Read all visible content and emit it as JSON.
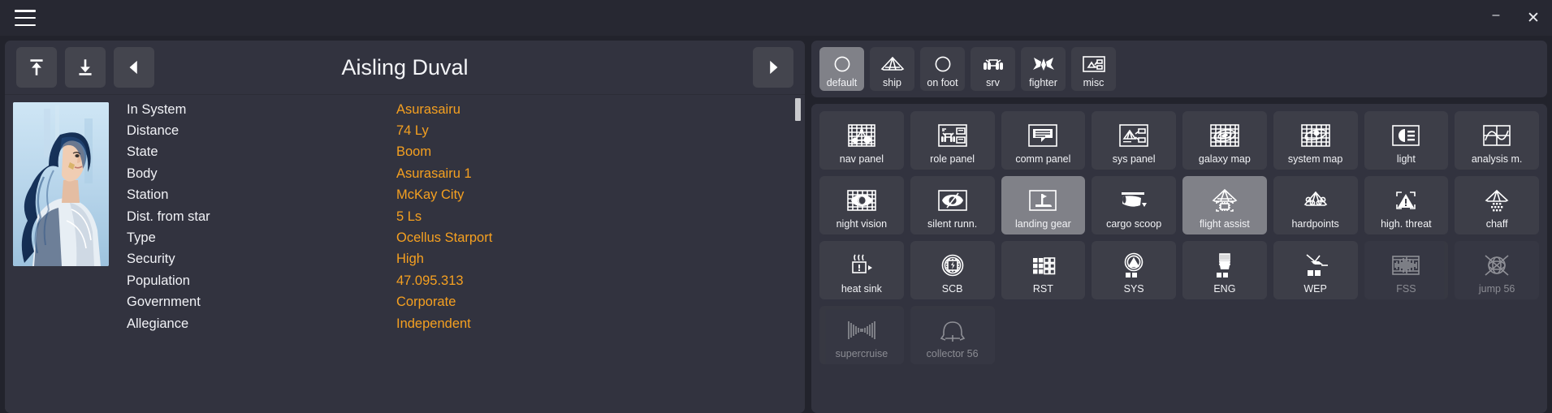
{
  "window": {
    "menu_icon": "hamburger-icon",
    "minimize_label": "–",
    "close_label": "✕"
  },
  "card": {
    "title": "Aisling Duval",
    "buttons": {
      "first_label": "to-top",
      "last_label": "to-bottom",
      "prev_label": "previous",
      "next_label": "next"
    }
  },
  "details": [
    {
      "label": "In System",
      "value": "Asurasairu"
    },
    {
      "label": "Distance",
      "value": "74 Ly"
    },
    {
      "label": "State",
      "value": "Boom"
    },
    {
      "label": "Body",
      "value": "Asurasairu 1"
    },
    {
      "label": "Station",
      "value": "McKay City"
    },
    {
      "label": "Dist. from star",
      "value": "5 Ls"
    },
    {
      "label": "Type",
      "value": "Ocellus Starport"
    },
    {
      "label": "Security",
      "value": "High"
    },
    {
      "label": "Population",
      "value": "47.095.313"
    },
    {
      "label": "Government",
      "value": "Corporate"
    },
    {
      "label": "Allegiance",
      "value": "Independent"
    }
  ],
  "tabs": [
    {
      "label": "default",
      "icon": "circle-icon",
      "active": true
    },
    {
      "label": "ship",
      "icon": "ship-icon",
      "active": false
    },
    {
      "label": "on foot",
      "icon": "circle-icon",
      "active": false
    },
    {
      "label": "srv",
      "icon": "srv-icon",
      "active": false
    },
    {
      "label": "fighter",
      "icon": "fighter-icon",
      "active": false
    },
    {
      "label": "misc",
      "icon": "misc-icon",
      "active": false
    }
  ],
  "grid": [
    {
      "label": "nav panel",
      "icon": "nav-panel-icon",
      "active": false,
      "dim": false
    },
    {
      "label": "role panel",
      "icon": "role-panel-icon",
      "active": false,
      "dim": false
    },
    {
      "label": "comm panel",
      "icon": "comm-panel-icon",
      "active": false,
      "dim": false
    },
    {
      "label": "sys panel",
      "icon": "sys-panel-icon",
      "active": false,
      "dim": false
    },
    {
      "label": "galaxy map",
      "icon": "galaxy-map-icon",
      "active": false,
      "dim": false
    },
    {
      "label": "system map",
      "icon": "system-map-icon",
      "active": false,
      "dim": false
    },
    {
      "label": "light",
      "icon": "light-icon",
      "active": false,
      "dim": false
    },
    {
      "label": "analysis m.",
      "icon": "analysis-mode-icon",
      "active": false,
      "dim": false
    },
    {
      "label": "night vision",
      "icon": "night-vision-icon",
      "active": false,
      "dim": false
    },
    {
      "label": "silent runn.",
      "icon": "silent-running-icon",
      "active": false,
      "dim": false
    },
    {
      "label": "landing gear",
      "icon": "landing-gear-icon",
      "active": true,
      "dim": false
    },
    {
      "label": "cargo scoop",
      "icon": "cargo-scoop-icon",
      "active": false,
      "dim": false
    },
    {
      "label": "flight assist",
      "icon": "flight-assist-icon",
      "active": true,
      "dim": false
    },
    {
      "label": "hardpoints",
      "icon": "hardpoints-icon",
      "active": false,
      "dim": false
    },
    {
      "label": "high. threat",
      "icon": "highest-threat-icon",
      "active": false,
      "dim": false
    },
    {
      "label": "chaff",
      "icon": "chaff-icon",
      "active": false,
      "dim": false
    },
    {
      "label": "heat sink",
      "icon": "heat-sink-icon",
      "active": false,
      "dim": false
    },
    {
      "label": "SCB",
      "icon": "shield-cell-bank-icon",
      "active": false,
      "dim": false
    },
    {
      "label": "RST",
      "icon": "reset-pips-icon",
      "active": false,
      "dim": false
    },
    {
      "label": "SYS",
      "icon": "sys-pips-icon",
      "active": false,
      "dim": false
    },
    {
      "label": "ENG",
      "icon": "eng-pips-icon",
      "active": false,
      "dim": false
    },
    {
      "label": "WEP",
      "icon": "wep-pips-icon",
      "active": false,
      "dim": false
    },
    {
      "label": "FSS",
      "icon": "fss-icon",
      "active": false,
      "dim": true
    },
    {
      "label": "jump 56",
      "icon": "jump-icon",
      "active": false,
      "dim": true
    },
    {
      "label": "supercruise",
      "icon": "supercruise-icon",
      "active": false,
      "dim": true
    },
    {
      "label": "collector 56",
      "icon": "collector-limpet-icon",
      "active": false,
      "dim": true
    }
  ],
  "colors": {
    "accent_value": "#f5a020",
    "panel_bg": "#32333f",
    "tile_bg": "#3d3e48",
    "tile_active_bg": "#808188",
    "window_bg": "#272832"
  }
}
